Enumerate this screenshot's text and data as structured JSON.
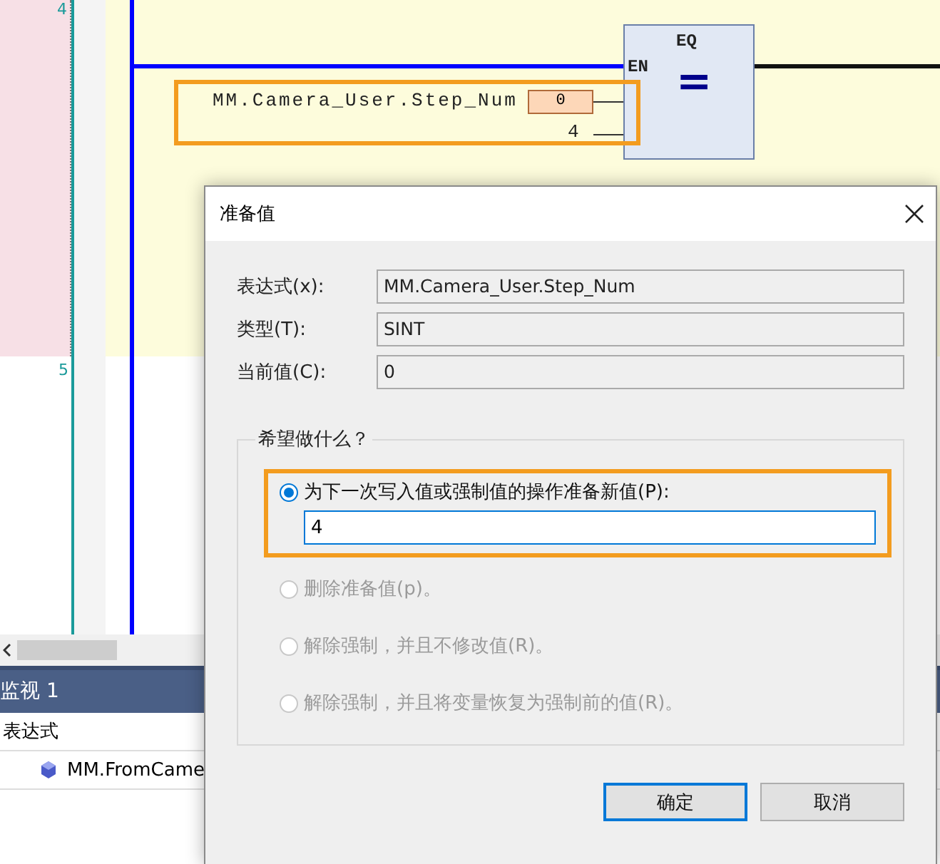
{
  "editor": {
    "line_numbers": [
      "4",
      "5"
    ],
    "eq_block": {
      "title": "EQ",
      "enable_label": "EN",
      "operator": "="
    },
    "inputs_highlighted": true,
    "inputs": [
      {
        "name": "MM.Camera_User.Step_Num",
        "value": "0"
      },
      {
        "name": "4"
      }
    ]
  },
  "watch": {
    "title": "监视 1",
    "column": "表达式",
    "rows": [
      {
        "name": "MM.FromCame"
      }
    ]
  },
  "dialog": {
    "title": "准备值",
    "fields": [
      {
        "label": "表达式(x):",
        "value": "MM.Camera_User.Step_Num"
      },
      {
        "label": "类型(T):",
        "value": "SINT"
      },
      {
        "label": "当前值(C):",
        "value": "0"
      }
    ],
    "group_title": "希望做什么？",
    "options": [
      {
        "label": "为下一次写入值或强制值的操作准备新值(P):",
        "selected": true,
        "disabled": false,
        "highlighted": true,
        "value": "4"
      },
      {
        "label": "删除准备值(p)。",
        "selected": false,
        "disabled": true,
        "highlighted": false
      },
      {
        "label": "解除强制，并且不修改值(R)。",
        "selected": false,
        "disabled": true,
        "highlighted": false
      },
      {
        "label": "解除强制，并且将变量恢复为强制前的值(R)。",
        "selected": false,
        "disabled": true,
        "highlighted": false
      }
    ],
    "buttons": [
      {
        "label": "确定",
        "default": true
      },
      {
        "label": "取消",
        "default": false
      }
    ]
  }
}
